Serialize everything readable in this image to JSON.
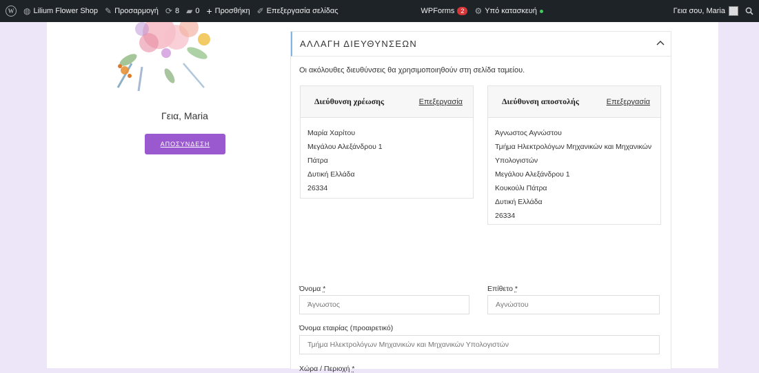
{
  "adminbar": {
    "site_name": "Lilium Flower Shop",
    "customize": "Προσαρμογή",
    "updates_count": "8",
    "comments_count": "0",
    "new": "Προσθήκη",
    "edit_page": "Επεξεργασία σελίδας",
    "wpforms": "WPForms",
    "wpforms_badge": "2",
    "maintenance": "Υπό κατασκευή",
    "howdy": "Γεια σου, Maria"
  },
  "sidebar": {
    "greeting": "Γεια, Maria",
    "logout": "ΑΠΟΣΥΝΔΕΣΗ"
  },
  "panel": {
    "title": "ΑΛΛΑΓΗ ΔΙΕΥΘΥΝΣΕΩΝ",
    "intro": "Οι ακόλουθες διευθύνσεις θα χρησιμοποιηθούν στη σελίδα ταμείου."
  },
  "billing": {
    "title": "Διεύθυνση χρέωσης",
    "edit": "Επεξεργασία",
    "lines": [
      "Μαρία Χαρίτου",
      "Μεγάλου Αλεξάνδρου 1",
      "Πάτρα",
      "Δυτική Ελλάδα",
      "26334"
    ]
  },
  "shipping": {
    "title": "Διεύθυνση αποστολής",
    "edit": "Επεξεργασία",
    "lines": [
      "Άγνωστος Αγνώστου",
      "Τμήμα Ηλεκτρολόγων Μηχανικών και Μηχανικών",
      "Υπολογιστών",
      "Μεγάλου Αλεξάνδρου 1",
      "Κουκούλι Πάτρα",
      "Δυτική Ελλάδα",
      "26334"
    ]
  },
  "form": {
    "first_name_label": "Όνομα",
    "first_name_value": "Άγνωστος",
    "last_name_label": "Επίθετο",
    "last_name_value": "Αγνώστου",
    "company_label": "Όνομα εταιρίας (προαιρετικό)",
    "company_value": "Τμήμα Ηλεκτρολόγων Μηχανικών και Μηχανικών Υπολογιστών",
    "required_mark": "*",
    "country_label": "Χώρα / Περιοχή"
  },
  "colors": {
    "background": "#ede6f8",
    "logout_button": "#9b59d0",
    "adminbar": "#1d2327"
  }
}
